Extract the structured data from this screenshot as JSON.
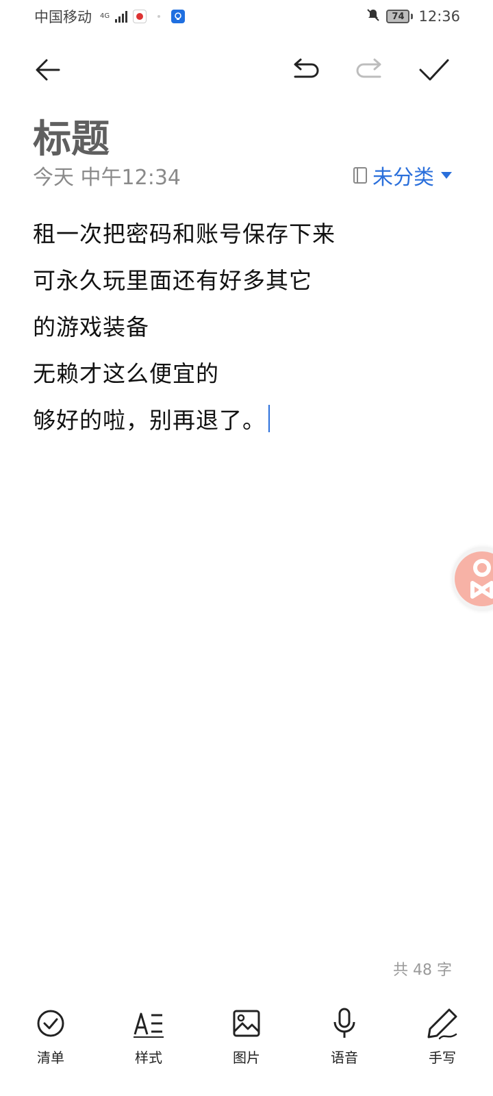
{
  "status_bar": {
    "carrier": "中国移动",
    "network": "4G",
    "battery": "74",
    "time": "12:36"
  },
  "toolbar": {
    "back_icon": "back-arrow-icon",
    "undo_icon": "undo-icon",
    "redo_icon": "redo-icon",
    "done_icon": "check-icon"
  },
  "note": {
    "title": "标题",
    "timestamp": "今天 中午12:34",
    "category": "未分类",
    "lines": [
      "租一次把密码和账号保存下来",
      "可永久玩里面还有好多其它",
      "的游戏装备",
      "无赖才这么便宜的",
      "够好的啦，别再退了。"
    ]
  },
  "word_count": "共 48 字",
  "bottom_toolbar": {
    "checklist": "清单",
    "style": "样式",
    "image": "图片",
    "voice": "语音",
    "handwriting": "手写"
  },
  "colors": {
    "accent": "#2a6fdb",
    "title": "#5f5f5f",
    "meta": "#8a8a8a"
  }
}
